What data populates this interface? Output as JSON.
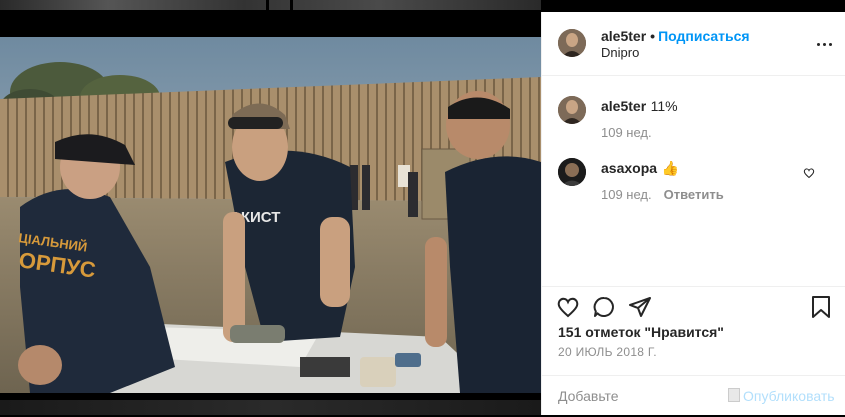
{
  "post": {
    "username": "ale5ter",
    "follow_label": "Подписаться",
    "location": "Dnipro",
    "separator": "•"
  },
  "comments": [
    {
      "user": "ale5ter",
      "text": "11%",
      "age": "109 нед.",
      "reply_label": ""
    },
    {
      "user": "asaxopa",
      "text": "👍",
      "age": "109 нед.",
      "reply_label": "Ответить"
    }
  ],
  "actions": {
    "like_icon": "heart-icon",
    "comment_icon": "comment-icon",
    "share_icon": "paper-plane-icon",
    "save_icon": "bookmark-icon"
  },
  "likes_text": "151 отметок \"Нравится\"",
  "date_text": "20 ИЮЛЬ 2018 Г.",
  "add_comment": {
    "placeholder": "Добавьте",
    "publish_label": "Опубликовать"
  },
  "colors": {
    "accent": "#0095f6",
    "publish_disabled": "#b2dffc",
    "muted": "#8e8e8e",
    "text": "#262626"
  }
}
